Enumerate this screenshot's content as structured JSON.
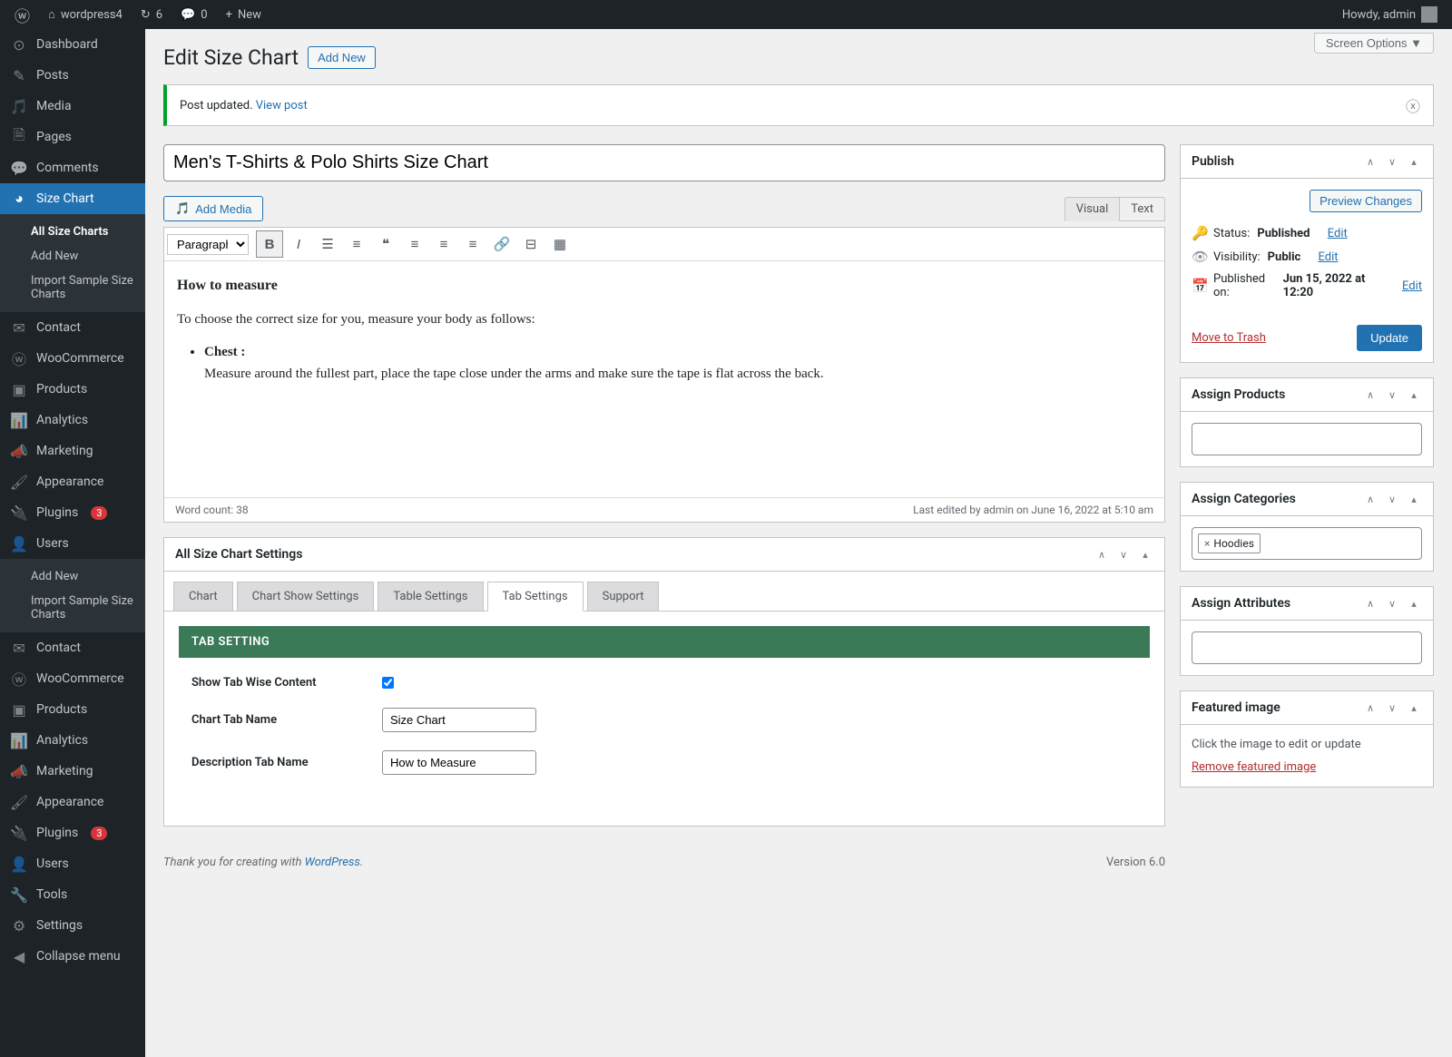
{
  "adminBar": {
    "siteName": "wordpress4",
    "updates": "6",
    "comments": "0",
    "newLabel": "New",
    "howdy": "Howdy, admin"
  },
  "menu": {
    "dashboard": "Dashboard",
    "posts": "Posts",
    "media": "Media",
    "pages": "Pages",
    "comments": "Comments",
    "sizeChart": "Size Chart",
    "sub_allSizeCharts": "All Size Charts",
    "sub_addNew": "Add New",
    "sub_importSample": "Import Sample Size Charts",
    "contact": "Contact",
    "woocommerce": "WooCommerce",
    "products": "Products",
    "analytics": "Analytics",
    "marketing": "Marketing",
    "appearance": "Appearance",
    "plugins": "Plugins",
    "pluginsBadge": "3",
    "users": "Users",
    "tools": "Tools",
    "settings": "Settings",
    "collapse": "Collapse menu"
  },
  "screenOptions": "Screen Options ▼",
  "pageTitle": "Edit Size Chart",
  "addNewBtn": "Add New",
  "notice": {
    "text": "Post updated. ",
    "link": "View post"
  },
  "postTitle": "Men's T-Shirts & Polo Shirts Size Chart",
  "addMedia": "Add Media",
  "editorTabs": {
    "visual": "Visual",
    "text": "Text"
  },
  "formatSelect": "Paragraph",
  "editorContent": {
    "heading": "How to measure",
    "intro": "To choose the correct size for you, measure your body as follows:",
    "bulletTitle": "Chest :",
    "bulletText": "Measure around the fullest part, place the tape close under the arms and make sure the tape is flat across the back."
  },
  "wordCount": "Word count: 38",
  "lastEdited": "Last edited by admin on June 16, 2022 at 5:10 am",
  "publish": {
    "title": "Publish",
    "preview": "Preview Changes",
    "statusLabel": "Status: ",
    "status": "Published",
    "visibilityLabel": "Visibility: ",
    "visibility": "Public",
    "publishedLabel": "Published on: ",
    "publishedDate": "Jun 15, 2022 at 12:20",
    "edit": "Edit",
    "trash": "Move to Trash",
    "update": "Update"
  },
  "assignProducts": "Assign Products",
  "assignCategories": "Assign Categories",
  "categoryToken": "Hoodies",
  "assignAttributes": "Assign Attributes",
  "featuredImage": {
    "title": "Featured image",
    "msg": "Click the image to edit or update",
    "remove": "Remove featured image"
  },
  "settingsPanel": {
    "title": "All Size Chart Settings",
    "tabs": {
      "chart": "Chart",
      "show": "Chart Show Settings",
      "table": "Table Settings",
      "tab": "Tab Settings",
      "support": "Support"
    },
    "banner": "TAB SETTING",
    "showTabWise": "Show Tab Wise Content",
    "chartTabName": "Chart Tab Name",
    "chartTabValue": "Size Chart",
    "descTabName": "Description Tab Name",
    "descTabValue": "How to Measure"
  },
  "footer": {
    "thanks": "Thank you for creating with ",
    "wp": "WordPress",
    "version": "Version 6.0"
  }
}
